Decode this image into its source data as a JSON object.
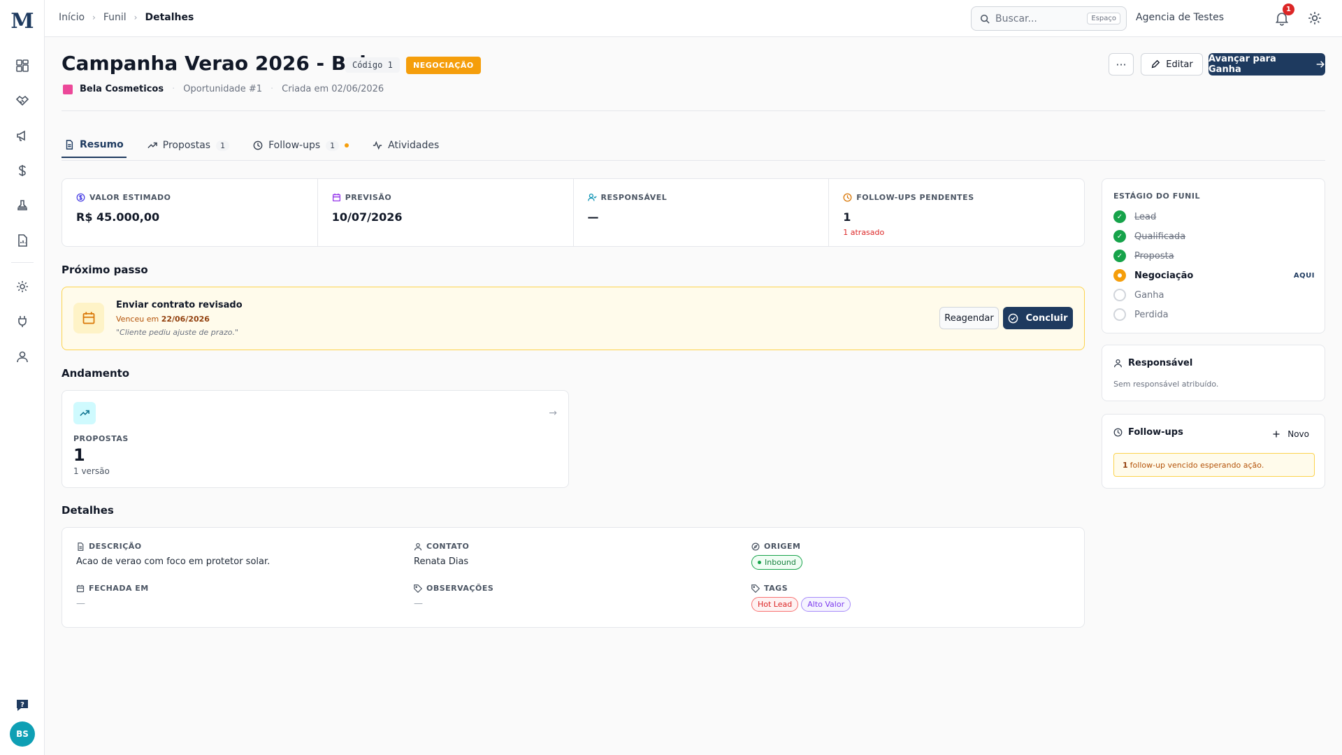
{
  "app": {
    "logo": "M"
  },
  "sidebar": {
    "icons": [
      "dashboard-icon",
      "handshake-icon",
      "megaphone-icon",
      "dollar-icon",
      "stamp-icon",
      "report-icon",
      "gear-icon",
      "plug-icon",
      "user-icon"
    ],
    "avatar_initials": "BS"
  },
  "topbar": {
    "breadcrumb": [
      "Início",
      "Funil",
      "Detalhes"
    ],
    "search_placeholder": "Buscar...",
    "search_shortcut": "Espaço",
    "agency": "Agencia de Testes",
    "notifications": "1"
  },
  "header": {
    "title": "Campanha Verao 2026 - Bela",
    "code": "Código 1",
    "stage_badge": "NEGOCIAÇÃO",
    "company": "Bela Cosmeticos",
    "opportunity": "Oportunidade #1",
    "created": "Criada em 02/06/2026",
    "more_label": "···",
    "edit_label": "Editar",
    "advance_label": "Avançar para Ganha"
  },
  "tabs": [
    {
      "label": "Resumo",
      "count": ""
    },
    {
      "label": "Propostas",
      "count": "1"
    },
    {
      "label": "Follow-ups",
      "count": "1"
    },
    {
      "label": "Atividades",
      "count": ""
    }
  ],
  "kpis": [
    {
      "label": "VALOR ESTIMADO",
      "value": "R$ 45.000,00",
      "sub": ""
    },
    {
      "label": "PREVISÃO",
      "value": "10/07/2026",
      "sub": ""
    },
    {
      "label": "RESPONSÁVEL",
      "value": "—",
      "sub": ""
    },
    {
      "label": "FOLLOW-UPS PENDENTES",
      "value": "1",
      "sub": "1 atrasado"
    }
  ],
  "next_step": {
    "section": "Próximo passo",
    "title": "Enviar contrato revisado",
    "due_prefix": "Venceu em",
    "due_date": "22/06/2026",
    "note": "\"Cliente pediu ajuste de prazo.\"",
    "reschedule_label": "Reagendar",
    "complete_label": "Concluir"
  },
  "progress": {
    "section": "Andamento",
    "label": "PROPOSTAS",
    "value": "1",
    "sub": "1 versão"
  },
  "details": {
    "section": "Detalhes",
    "description_label": "DESCRIÇÃO",
    "description": "Acao de verao com foco em protetor solar.",
    "contact_label": "CONTATO",
    "contact": "Renata Dias",
    "origin_label": "ORIGEM",
    "origin": "Inbound",
    "closed_label": "FECHADA EM",
    "closed": "—",
    "notes_label": "OBSERVAÇÕES",
    "notes": "—",
    "tags_label": "TAGS",
    "tags": [
      "Hot Lead",
      "Alto Valor"
    ]
  },
  "funnel": {
    "label": "ESTÁGIO DO FUNIL",
    "stages": [
      {
        "name": "Lead",
        "state": "done"
      },
      {
        "name": "Qualificada",
        "state": "done"
      },
      {
        "name": "Proposta",
        "state": "done"
      },
      {
        "name": "Negociação",
        "state": "current"
      },
      {
        "name": "Ganha",
        "state": "todo"
      },
      {
        "name": "Perdida",
        "state": "todo"
      }
    ],
    "current_marker": "AQUI",
    "check_glyph": "✓"
  },
  "responsible": {
    "title": "Responsável",
    "empty": "Sem responsável atribuído."
  },
  "followups": {
    "title": "Follow-ups",
    "new_label": "Novo",
    "alert_count": "1",
    "alert_text": "follow-up vencido esperando ação."
  },
  "colors": {
    "primary": "#1e3a5f",
    "warning": "#f59e0b",
    "success": "#16a34a",
    "danger": "#dc2626"
  }
}
